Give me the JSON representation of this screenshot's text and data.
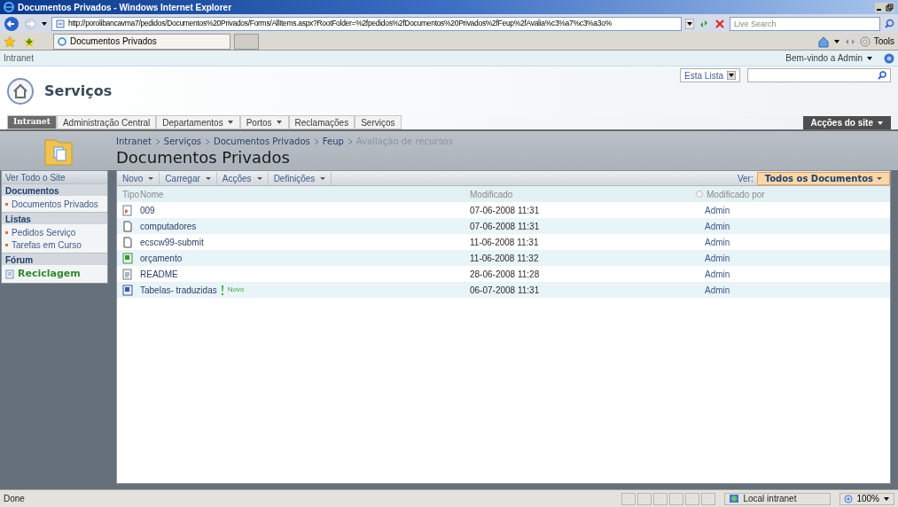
{
  "window": {
    "title": "Documentos Privados - Windows Internet Explorer"
  },
  "address_bar": {
    "url": "http://porolibancavma7/pedidos/Documentos%20Privados/Forms/AllItems.aspx?RootFolder=%2fpedidos%2fDocumentos%20Privados%2fFeup%2fAvalia%c3%a7%c3%a3o%",
    "search_placeholder": "Live Search"
  },
  "browser_tabs": [
    {
      "label": "Documentos Privados",
      "selected": true
    }
  ],
  "command_bar": {
    "tools": "Tools"
  },
  "site": {
    "top_link": "Intranet",
    "welcome": "Bem-vindo a Admin",
    "title": "Serviços",
    "search_scope": "Esta Lista",
    "site_actions": "Acções do site"
  },
  "nav_tabs": [
    {
      "label": "Intranet",
      "selected": true,
      "menu": false
    },
    {
      "label": "Administração Central",
      "selected": false,
      "menu": false
    },
    {
      "label": "Departamentos",
      "selected": false,
      "menu": true
    },
    {
      "label": "Portos",
      "selected": false,
      "menu": true
    },
    {
      "label": "Reclamações",
      "selected": false,
      "menu": false
    },
    {
      "label": "Serviços",
      "selected": false,
      "menu": false
    }
  ],
  "breadcrumb": [
    {
      "label": "Intranet",
      "current": false
    },
    {
      "label": "Serviços",
      "current": false
    },
    {
      "label": "Documentos Privados",
      "current": false
    },
    {
      "label": "Feup",
      "current": false
    },
    {
      "label": "Avaliação de recursos",
      "current": true
    }
  ],
  "page_title": "Documentos Privados",
  "sidebar": {
    "view_all": "Ver Todo o Site",
    "sections": [
      {
        "heading": "Documentos",
        "items": [
          "Documentos Privados"
        ]
      },
      {
        "heading": "Listas",
        "items": [
          "Pedidos Serviço",
          "Tarefas em Curso"
        ]
      },
      {
        "heading": "Fórum"
      }
    ],
    "recycle": "Reciclagem"
  },
  "toolbar": [
    {
      "label": "Novo"
    },
    {
      "label": "Carregar"
    },
    {
      "label": "Acções"
    },
    {
      "label": "Definições"
    }
  ],
  "view": {
    "label": "Ver:",
    "value": "Todos os Documentos"
  },
  "table": {
    "columns": [
      "Tipo",
      "Nome",
      "Modificado",
      "Modificado por"
    ],
    "rows": [
      {
        "kind": "image",
        "name": "009",
        "modified": "07-06-2008 11:31",
        "by": "Admin",
        "new": false
      },
      {
        "kind": "blank",
        "name": "computadores",
        "modified": "07-06-2008 11:31",
        "by": "Admin",
        "new": false
      },
      {
        "kind": "blank",
        "name": "ecscw99-submit",
        "modified": "11-06-2008 11:31",
        "by": "Admin",
        "new": false
      },
      {
        "kind": "sheet",
        "name": "orçamento",
        "modified": "11-06-2008 11:32",
        "by": "Admin",
        "new": false
      },
      {
        "kind": "text",
        "name": "README",
        "modified": "28-06-2008 11:28",
        "by": "Admin",
        "new": false
      },
      {
        "kind": "doc",
        "name": "Tabelas- traduzidas",
        "modified": "06-07-2008 11:31",
        "by": "Admin",
        "new": true,
        "new_label": "Novo"
      }
    ]
  },
  "status_bar": {
    "status": "Done",
    "zone": "Local intranet",
    "zoom": "100%"
  }
}
